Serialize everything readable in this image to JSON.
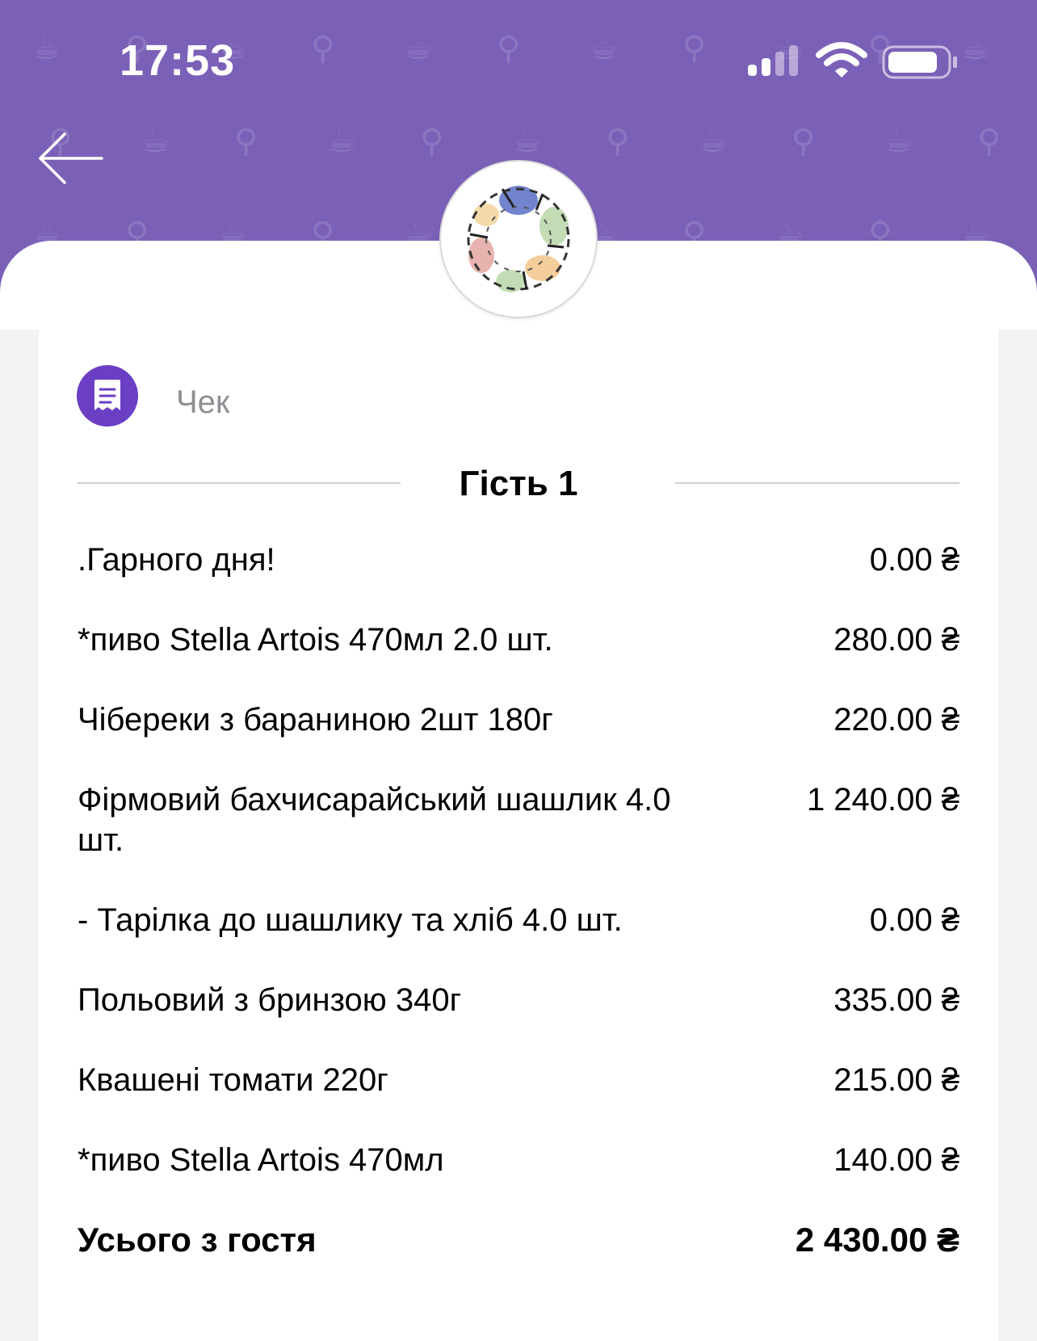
{
  "status_bar": {
    "time": "17:53"
  },
  "header": {
    "back_icon": "arrow-left-icon",
    "logo": "restaurant-logo",
    "background_color": "#7b60b7"
  },
  "receipt": {
    "icon": "receipt-icon",
    "title": "Чек",
    "guest_title": "Гість 1",
    "items": [
      {
        "name": ".Гарного дня!",
        "price": "0.00 ₴"
      },
      {
        "name": "*пиво Stella Artois  470мл 2.0 шт.",
        "price": "280.00 ₴"
      },
      {
        "name": "Чібереки з бараниною 2шт 180г",
        "price": "220.00 ₴"
      },
      {
        "name": "Фірмовий бахчисарайський шашлик 4.0 шт.",
        "price": "1 240.00 ₴"
      },
      {
        "name": "- Тарілка до шашлику та хліб 4.0 шт.",
        "price": "0.00 ₴"
      },
      {
        "name": "Польовий з бринзою 340г",
        "price": "335.00 ₴"
      },
      {
        "name": "Квашені томати 220г",
        "price": "215.00 ₴"
      },
      {
        "name": "*пиво Stella Artois  470мл",
        "price": "140.00 ₴"
      }
    ],
    "total_label": "Усього з гостя",
    "total_value": "2 430.00 ₴"
  }
}
